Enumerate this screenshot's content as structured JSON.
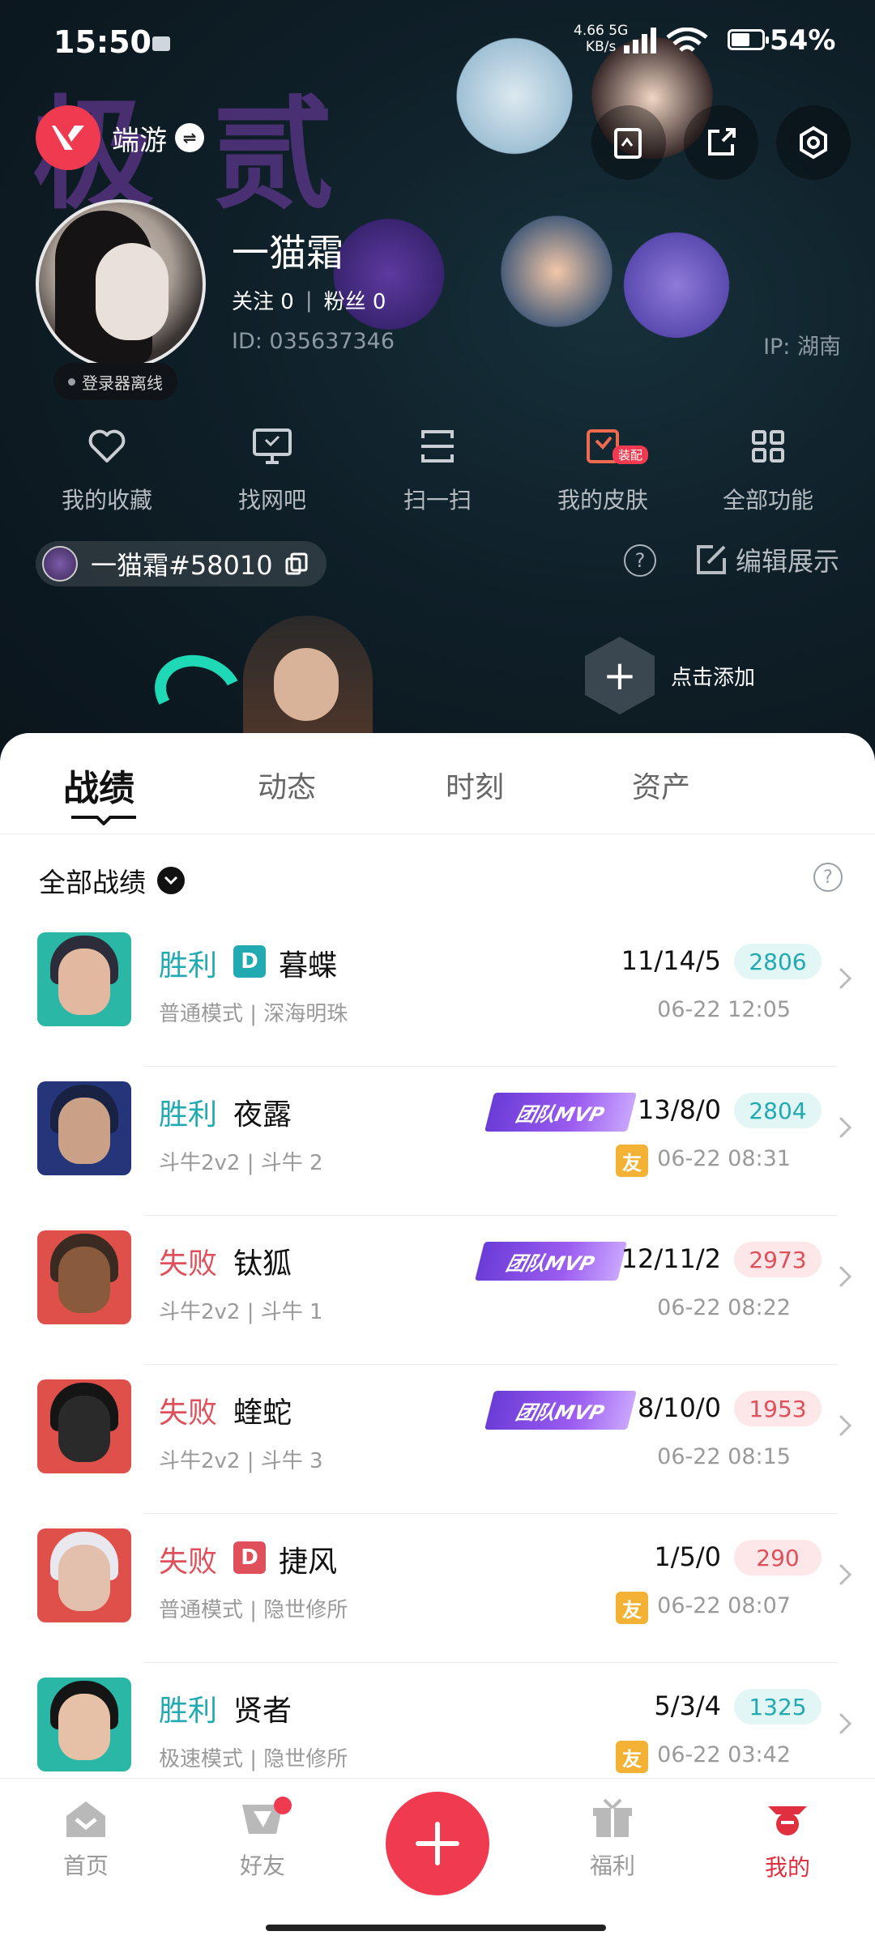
{
  "status": {
    "time": "15:50",
    "net_speed": "4.66",
    "net_unit": "KB/s",
    "net_type": "5G",
    "battery": "54%"
  },
  "header": {
    "brand": "端游",
    "username": "一猫霜",
    "follow_label": "关注 0",
    "fans_label": "粉丝 0",
    "id": "ID: 035637346",
    "ip": "IP: 湖南",
    "login_status": "登录器离线",
    "game_id": "一猫霜#58010",
    "edit_label": "编辑展示",
    "add_label": "点击添加"
  },
  "quick_actions": [
    {
      "label": "我的收藏",
      "icon": "heart-icon"
    },
    {
      "label": "找网吧",
      "icon": "monitor-icon"
    },
    {
      "label": "扫一扫",
      "icon": "scan-icon"
    },
    {
      "label": "我的皮肤",
      "icon": "skin-icon",
      "tag": "装配"
    },
    {
      "label": "全部功能",
      "icon": "grid-icon"
    }
  ],
  "tabs": [
    {
      "label": "战绩",
      "active": true
    },
    {
      "label": "动态"
    },
    {
      "label": "时刻"
    },
    {
      "label": "资产"
    }
  ],
  "filter": {
    "label": "全部战绩"
  },
  "matches": [
    {
      "result": "胜利",
      "badge": "D",
      "agent": "暮蝶",
      "mode": "普通模式 | 深海明珠",
      "kda": "11/14/5",
      "score": "2806",
      "time": "06-22 12:05",
      "mvp": "",
      "friend": ""
    },
    {
      "result": "胜利",
      "badge": "",
      "agent": "夜露",
      "mode": "斗牛2v2 | 斗牛 2",
      "kda": "13/8/0",
      "score": "2804",
      "time": "06-22 08:31",
      "mvp": "团队MVP",
      "friend": "友"
    },
    {
      "result": "失败",
      "badge": "",
      "agent": "钛狐",
      "mode": "斗牛2v2 | 斗牛 1",
      "kda": "12/11/2",
      "score": "2973",
      "time": "06-22 08:22",
      "mvp": "团队MVP",
      "friend": ""
    },
    {
      "result": "失败",
      "badge": "",
      "agent": "蝰蛇",
      "mode": "斗牛2v2 | 斗牛 3",
      "kda": "8/10/0",
      "score": "1953",
      "time": "06-22 08:15",
      "mvp": "团队MVP",
      "friend": ""
    },
    {
      "result": "失败",
      "badge": "D",
      "agent": "捷风",
      "mode": "普通模式 | 隐世修所",
      "kda": "1/5/0",
      "score": "290",
      "time": "06-22 08:07",
      "mvp": "",
      "friend": "友"
    },
    {
      "result": "胜利",
      "badge": "",
      "agent": "贤者",
      "mode": "极速模式 | 隐世修所",
      "kda": "5/3/4",
      "score": "1325",
      "time": "06-22 03:42",
      "mvp": "",
      "friend": "友"
    }
  ],
  "bottom_nav": [
    {
      "label": "首页"
    },
    {
      "label": "好友"
    },
    {
      "label": "福利"
    },
    {
      "label": "我的",
      "active": true
    }
  ],
  "colors": {
    "accent": "#ef3a4f",
    "win": "#22aab2",
    "lose": "#e0505a",
    "mvp": "#8a52e8"
  }
}
